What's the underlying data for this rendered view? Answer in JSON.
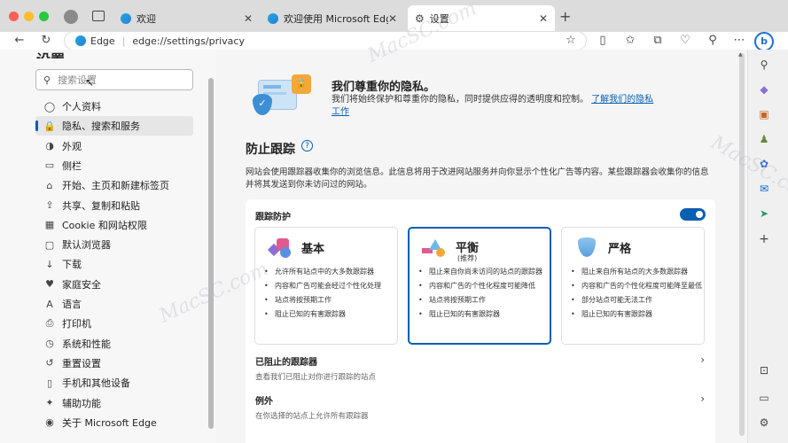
{
  "tabs": [
    {
      "label": "欢迎",
      "close": "✕"
    },
    {
      "label": "欢迎使用 Microsoft Edge Beta",
      "close": "✕"
    },
    {
      "label": "设置",
      "close": "✕"
    }
  ],
  "new_tab": "+",
  "address": {
    "site_label": "Edge",
    "url": "edge://settings/privacy"
  },
  "sidebar": {
    "title": "设置",
    "search_placeholder": "搜索设置",
    "items": [
      {
        "label": "个人资料",
        "icon": "person-icon"
      },
      {
        "label": "隐私、搜索和服务",
        "icon": "lock-icon"
      },
      {
        "label": "外观",
        "icon": "appearance-icon"
      },
      {
        "label": "侧栏",
        "icon": "sidebar-icon"
      },
      {
        "label": "开始、主页和新建标签页",
        "icon": "home-icon"
      },
      {
        "label": "共享、复制和粘贴",
        "icon": "share-icon"
      },
      {
        "label": "Cookie 和网站权限",
        "icon": "cookie-icon"
      },
      {
        "label": "默认浏览器",
        "icon": "browser-icon"
      },
      {
        "label": "下载",
        "icon": "download-icon"
      },
      {
        "label": "家庭安全",
        "icon": "family-icon"
      },
      {
        "label": "语言",
        "icon": "language-icon"
      },
      {
        "label": "打印机",
        "icon": "printer-icon"
      },
      {
        "label": "系统和性能",
        "icon": "system-icon"
      },
      {
        "label": "重置设置",
        "icon": "reset-icon"
      },
      {
        "label": "手机和其他设备",
        "icon": "phone-icon"
      },
      {
        "label": "辅助功能",
        "icon": "accessibility-icon"
      },
      {
        "label": "关于 Microsoft Edge",
        "icon": "edge-icon"
      }
    ]
  },
  "privacy": {
    "title": "我们尊重你的隐私。",
    "desc": "我们将始终保护和尊重你的隐私，同时提供应得的透明度和控制。",
    "link": "了解我们的隐私工作"
  },
  "tracking": {
    "title": "防止跟踪",
    "help": "?",
    "desc": "网站会使用跟踪器收集你的浏览信息。此信息将用于改进网站服务并向你显示个性化广告等内容。某些跟踪器会收集你的信息并将其发送到你未访问过的网站。",
    "toggle_label": "跟踪防护",
    "toggle_on": true,
    "levels": [
      {
        "name": "基本",
        "sub": "",
        "bullets": [
          "允许所有站点中的大多数跟踪器",
          "内容和广告可能会经过个性化处理",
          "站点将按预期工作",
          "阻止已知的有害跟踪器"
        ]
      },
      {
        "name": "平衡",
        "sub": "(推荐)",
        "bullets": [
          "阻止来自你尚未访问的站点的跟踪器",
          "内容和广告的个性化程度可能降低",
          "站点将按预期工作",
          "阻止已知的有害跟踪器"
        ]
      },
      {
        "name": "严格",
        "sub": "",
        "bullets": [
          "阻止来自所有站点的大多数跟踪器",
          "内容和广告的个性化程度可能降至最低",
          "部分站点可能无法工作",
          "阻止已知的有害跟踪器"
        ]
      }
    ],
    "blocked": {
      "title": "已阻止的跟踪器",
      "desc": "查看我们已阻止对你进行跟踪的站点"
    },
    "exceptions": {
      "title": "例外",
      "desc": "在你选择的站点上允许所有跟踪器"
    }
  },
  "watermark": "MacSC.com",
  "colors": {
    "accent": "#0a5fb0",
    "selected_border": "#0a5fb0"
  }
}
